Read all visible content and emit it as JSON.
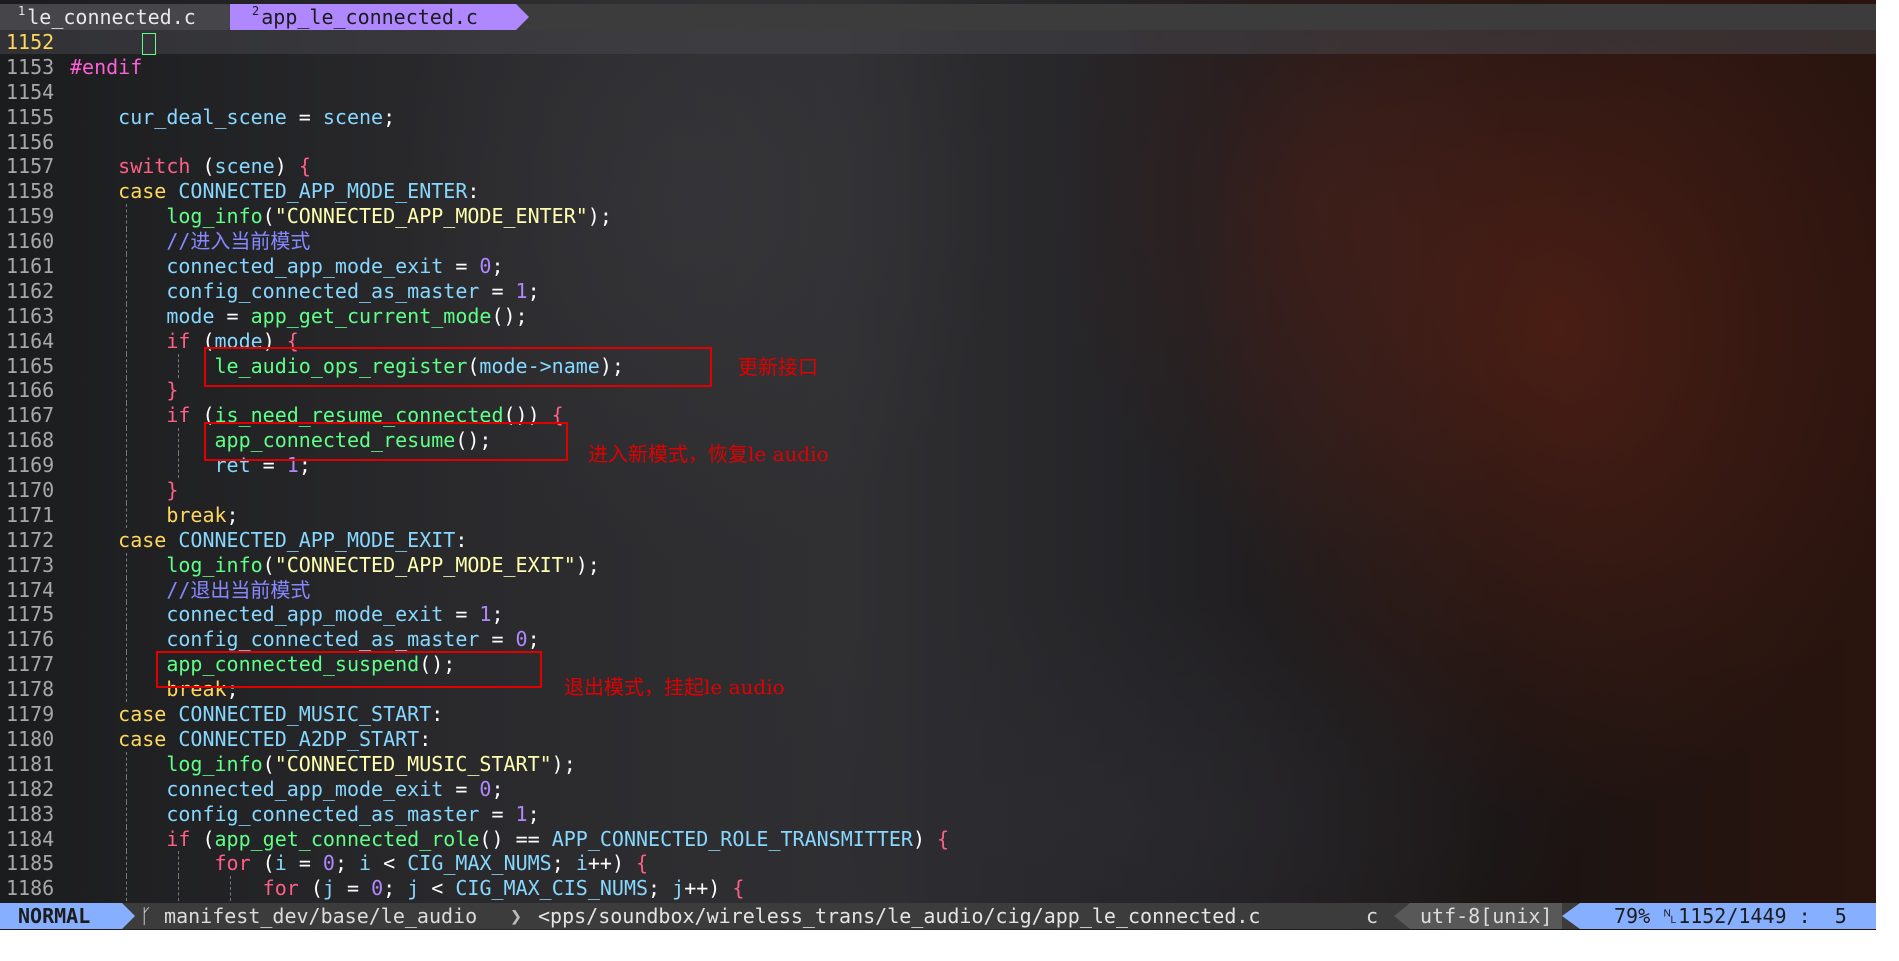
{
  "tabs": [
    {
      "num": "1",
      "name": "le_connected.c"
    },
    {
      "num": "2",
      "name": "app_le_connected.c"
    }
  ],
  "lines": [
    "1152",
    "1153",
    "1154",
    "1155",
    "1156",
    "1157",
    "1158",
    "1159",
    "1160",
    "1161",
    "1162",
    "1163",
    "1164",
    "1165",
    "1166",
    "1167",
    "1168",
    "1169",
    "1170",
    "1171",
    "1172",
    "1173",
    "1174",
    "1175",
    "1176",
    "1177",
    "1178",
    "1179",
    "1180",
    "1181",
    "1182",
    "1183",
    "1184",
    "1185",
    "1186"
  ],
  "code": {
    "endif": "#endif",
    "cur_deal_scene": "cur_deal_scene",
    "scene": "scene",
    "switch": "switch",
    "case": "case",
    "enter_macro": "CONNECTED_APP_MODE_ENTER",
    "exit_macro": "CONNECTED_APP_MODE_EXIT",
    "music_macro": "CONNECTED_MUSIC_START",
    "a2dp_macro": "CONNECTED_A2DP_START",
    "log_info": "log_info",
    "str_enter": "\"CONNECTED_APP_MODE_ENTER\"",
    "str_exit": "\"CONNECTED_APP_MODE_EXIT\"",
    "str_music": "\"CONNECTED_MUSIC_START\"",
    "comment_enter": "//进入当前模式",
    "comment_exit": "//退出当前模式",
    "mode_exit_var": "connected_app_mode_exit",
    "master_var": "config_connected_as_master",
    "mode": "mode",
    "get_mode": "app_get_current_mode",
    "if": "if",
    "ops_register": "le_audio_ops_register",
    "mode_name": "mode->name",
    "is_need_resume": "is_need_resume_connected",
    "resume": "app_connected_resume",
    "ret": "ret",
    "break": "break",
    "suspend": "app_connected_suspend",
    "get_role": "app_get_connected_role",
    "role_tx": "APP_CONNECTED_ROLE_TRANSMITTER",
    "for": "for",
    "i": "i",
    "j": "j",
    "cig_max": "CIG_MAX_NUMS",
    "cis_max": "CIG_MAX_CIS_NUMS",
    "zero": "0",
    "one": "1"
  },
  "annotations": {
    "register": "更新接口",
    "resume": "进入新模式，恢复le audio",
    "suspend": "退出模式，挂起le audio"
  },
  "status": {
    "mode": "NORMAL",
    "branch": "manifest_dev/base/le_audio",
    "path": "<pps/soundbox/wireless_trans/le_audio/cig/app_le_connected.c",
    "filetype": "c",
    "encoding": "utf-8[unix]",
    "percent": "79%",
    "position": "1152/1449",
    "column": "5"
  },
  "colors": {
    "keyword": "#ff5f87",
    "function": "#5fff87",
    "identifier": "#87d7ff",
    "number": "#af87ff",
    "string": "#ffffaf",
    "comment": "#8787ff",
    "annotation": "#e00000",
    "mode_accent": "#87afff"
  }
}
